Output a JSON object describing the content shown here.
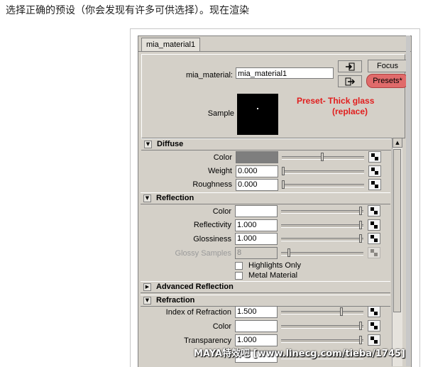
{
  "caption": "选择正确的预设（你会发现有许多可供选择）。现在渲染",
  "tab_label": "mia_material1",
  "header": {
    "name_label": "mia_material:",
    "name_value": "mia_material1",
    "focus_label": "Focus",
    "presets_label": "Presets*",
    "sample_label": "Sample"
  },
  "annotation": {
    "line1": "Preset- Thick glass",
    "line2": "(replace)"
  },
  "sections": {
    "diffuse": {
      "title": "Diffuse",
      "color_label": "Color",
      "color_value": "#7e7e7e",
      "weight_label": "Weight",
      "weight_value": "0.000",
      "roughness_label": "Roughness",
      "roughness_value": "0.000"
    },
    "reflection": {
      "title": "Reflection",
      "color_label": "Color",
      "color_value": "#ffffff",
      "reflectivity_label": "Reflectivity",
      "reflectivity_value": "1.000",
      "glossiness_label": "Glossiness",
      "glossiness_value": "1.000",
      "glossy_samples_label": "Glossy Samples",
      "glossy_samples_value": "8",
      "highlights_only_label": "Highlights Only",
      "metal_material_label": "Metal Material"
    },
    "advanced_reflection": {
      "title": "Advanced Reflection"
    },
    "refraction": {
      "title": "Refraction",
      "ior_label": "Index of Refraction",
      "ior_value": "1.500",
      "color_label": "Color",
      "color_value": "#ffffff",
      "transparency_label": "Transparency",
      "transparency_value": "1.000"
    }
  },
  "slider_levels": {
    "diffuse_color": 0.5,
    "diffuse_weight": 0.0,
    "diffuse_roughness": 0.0,
    "reflection_color": 1.0,
    "reflectivity": 1.0,
    "glossiness": 1.0,
    "glossy_samples": 0.08,
    "ior": 0.75,
    "refraction_color": 1.0,
    "transparency": 1.0
  },
  "watermark": "MAYA特效吧 [www.linecg.com/tieba/1745]",
  "colors": {
    "panel_bg": "#d4d0c8",
    "presets_highlight": "#e06b6b",
    "annotation_red": "#e11d1d"
  }
}
